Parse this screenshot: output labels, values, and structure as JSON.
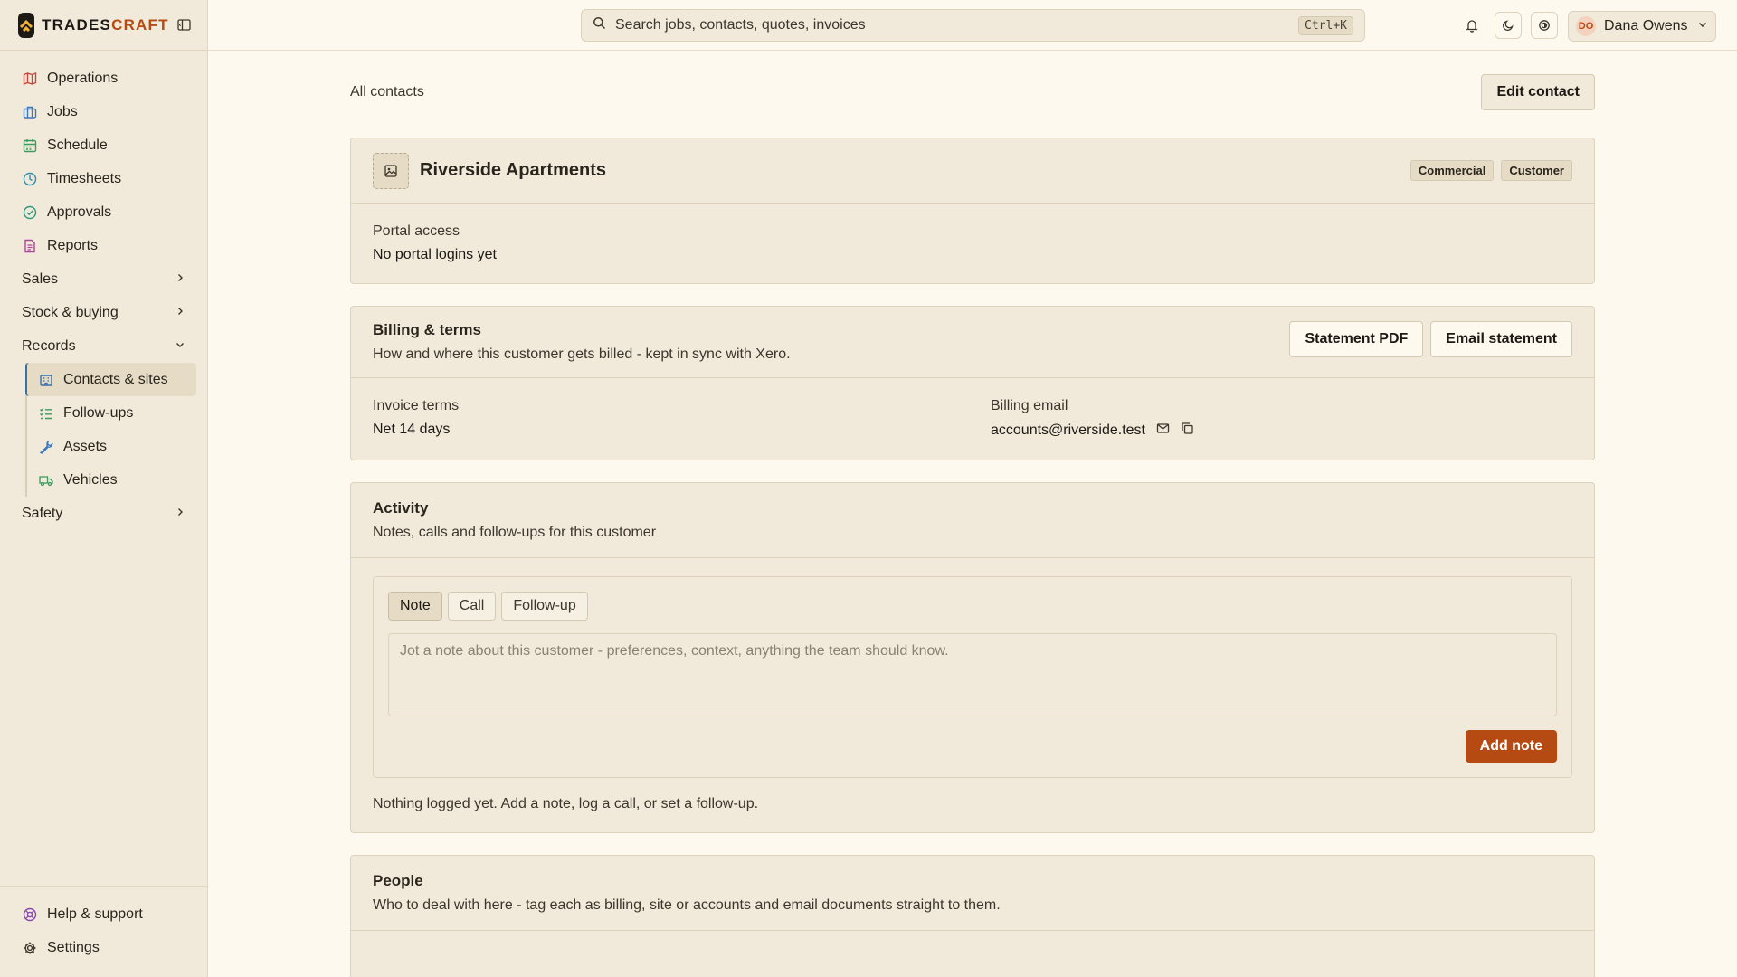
{
  "brand": {
    "name_main": "TRADES",
    "name_accent": "CRAFT",
    "accent_color": "#b54a12"
  },
  "sidebar": {
    "items": [
      {
        "label": "Operations",
        "icon": "map-icon"
      },
      {
        "label": "Jobs",
        "icon": "briefcase-icon"
      },
      {
        "label": "Schedule",
        "icon": "calendar-icon"
      },
      {
        "label": "Timesheets",
        "icon": "clock-icon"
      },
      {
        "label": "Approvals",
        "icon": "check-circle-icon"
      },
      {
        "label": "Reports",
        "icon": "document-icon"
      }
    ],
    "groups": {
      "sales": "Sales",
      "stock": "Stock & buying",
      "records": "Records",
      "safety": "Safety"
    },
    "records_items": [
      {
        "label": "Contacts & sites",
        "icon": "building-icon",
        "active": true
      },
      {
        "label": "Follow-ups",
        "icon": "checklist-icon"
      },
      {
        "label": "Assets",
        "icon": "wrench-icon"
      },
      {
        "label": "Vehicles",
        "icon": "truck-icon"
      }
    ],
    "footer": {
      "help": "Help & support",
      "settings": "Settings"
    }
  },
  "topbar": {
    "search_placeholder": "Search jobs, contacts, quotes, invoices",
    "shortcut": "Ctrl+K",
    "user_initials": "DO",
    "user_name": "Dana Owens"
  },
  "breadcrumb": "All contacts",
  "edit_button": "Edit contact",
  "contact": {
    "name": "Riverside Apartments",
    "badges": [
      "Commercial",
      "Customer"
    ],
    "portal_label": "Portal access",
    "portal_value": "No portal logins yet"
  },
  "billing": {
    "title": "Billing & terms",
    "subtitle": "How and where this customer gets billed - kept in sync with Xero.",
    "statement_pdf": "Statement PDF",
    "email_statement": "Email statement",
    "terms_label": "Invoice terms",
    "terms_value": "Net 14 days",
    "email_label": "Billing email",
    "email_value": "accounts@riverside.test"
  },
  "activity": {
    "title": "Activity",
    "subtitle": "Notes, calls and follow-ups for this customer",
    "tabs": [
      "Note",
      "Call",
      "Follow-up"
    ],
    "placeholder": "Jot a note about this customer - preferences, context, anything the team should know.",
    "add_button": "Add note",
    "empty": "Nothing logged yet. Add a note, log a call, or set a follow-up."
  },
  "people": {
    "title": "People",
    "subtitle": "Who to deal with here - tag each as billing, site or accounts and email documents straight to them."
  }
}
